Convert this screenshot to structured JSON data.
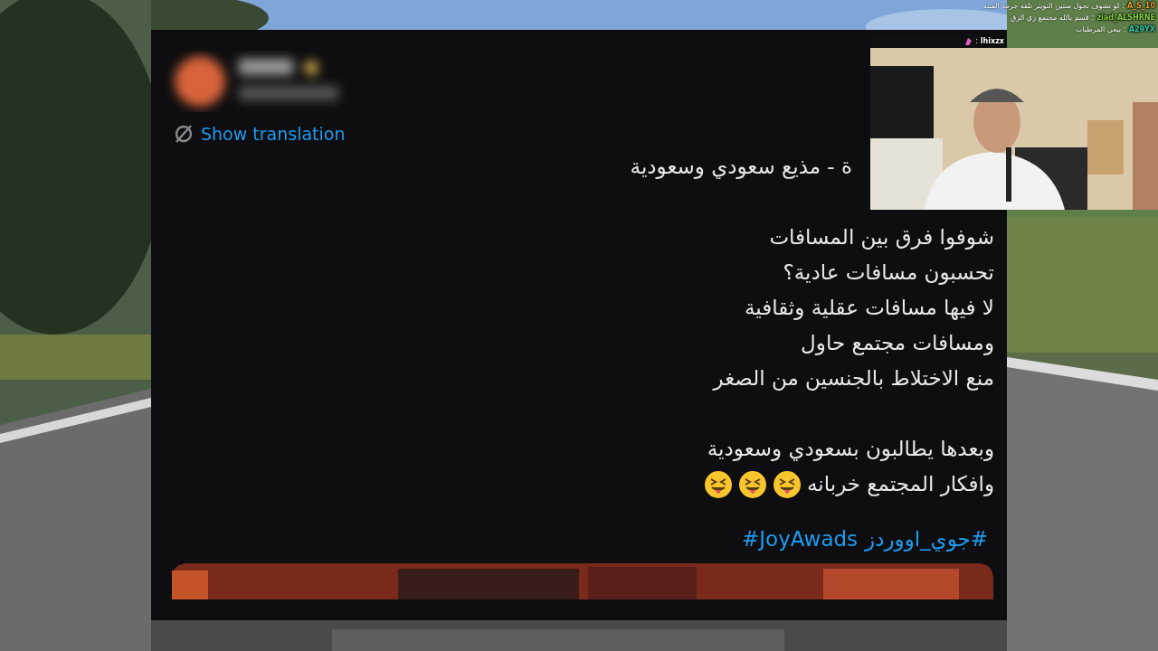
{
  "chat": [
    {
      "name": "A_S_10",
      "color": "#e39a2c",
      "separator": ":",
      "message": "لو تشوف تحول ستين التويتر تلقه جرمة الفتنه"
    },
    {
      "name": "ziad_ALSHRNE",
      "color": "#7fd13b",
      "separator": ":",
      "message": "قسم بالله مجتمع زي الزق"
    },
    {
      "name": "A29YX",
      "color": "#2ec4a6",
      "separator": ":",
      "message": "يبغي المرطبات"
    },
    {
      "name": "lhixzx",
      "color": "#ffffff",
      "separator": ":",
      "kind": "emote"
    }
  ],
  "tweet": {
    "show_translation": "Show translation",
    "lines": [
      {
        "text": "ة - مذيع سعودي وسعودية",
        "kind": "partial"
      },
      {
        "kind": "blank"
      },
      {
        "text": "شوفوا فرق بين المسافات"
      },
      {
        "text": "تحسبون مسافات عادية؟"
      },
      {
        "text": "لا فيها مسافات عقلية وثقافية"
      },
      {
        "text": "ومسافات مجتمع حاول"
      },
      {
        "text": "منع الاختلاط بالجنسين من الصغر"
      },
      {
        "kind": "blank"
      },
      {
        "text": "وبعدها يطالبون بسعودي وسعودية"
      },
      {
        "text": "وافكار المجتمع خربانه",
        "kind": "emoji"
      }
    ],
    "hashtags": [
      "#جوي_اووردز",
      "#JoyAwads"
    ]
  }
}
